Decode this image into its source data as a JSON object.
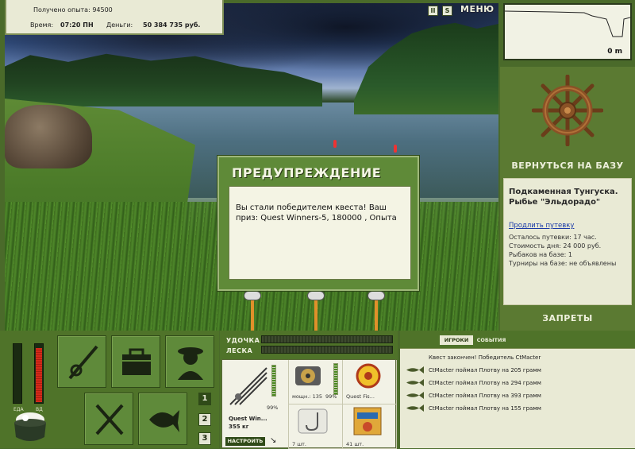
{
  "stats": {
    "experience_label": "Получено опыта: 94500",
    "time_label": "Время:",
    "time_value": "07:20 ПН",
    "money_label": "Деньги:",
    "money_value": "50 384 735 руб."
  },
  "top_bar": {
    "pause_label": "II",
    "sound_label": "S",
    "menu_label": "МЕНЮ"
  },
  "minimap": {
    "depth_value": "0 m"
  },
  "right_panel": {
    "return_label": "ВЕРНУТЬСЯ НА БАЗУ",
    "base_name": "Подкаменная Тунгуска. Рыбье \"Эльдорадо\"",
    "extend_link": "Продлить путевку",
    "lines": [
      "Осталось путевки: 17 час.",
      "Стоимость дня: 24 000 руб.",
      "Рыбаков на базе: 1",
      "Турниры на базе: не объявлены"
    ],
    "bans_label": "ЗАПРЕТЫ"
  },
  "dialog": {
    "title": "ПРЕДУПРЕЖДЕНИЕ",
    "message": "Вы стали победителем квеста! Ваш приз: Quest Winners-5, 180000 , Опыта"
  },
  "bottom_left": {
    "food_label": "ЕДА",
    "vodka_label": "ВД",
    "food_level": 0.0,
    "vodka_level": 0.92,
    "slot_buttons": [
      "1",
      "2",
      "3"
    ]
  },
  "tackle": {
    "rod_label": "УДОЧКА",
    "line_label": "ЛЕСКА",
    "rod_name": "Quest Win...",
    "rod_weight": "355 кг",
    "rod_percent": "99%",
    "reel_power": "мощн.: 135",
    "reel_percent": "99%",
    "line_name": "Quest Fis...",
    "hook_count": "7 шт.",
    "bait_count": "41 шт.",
    "setup_label": "НАСТРОИТЬ"
  },
  "events": {
    "tabs": [
      "ИГРОКИ",
      "СОБЫТИЯ"
    ],
    "header": "Квест закончен! Победитель CtMacter",
    "rows": [
      "CtMacter поймал Плотву на 205 грамм",
      "CtMacter поймал Плотву на 294 грамм",
      "CtMacter поймал Плотву на 393 грамм",
      "CtMacter поймал Плотву на 155 грамм"
    ]
  }
}
